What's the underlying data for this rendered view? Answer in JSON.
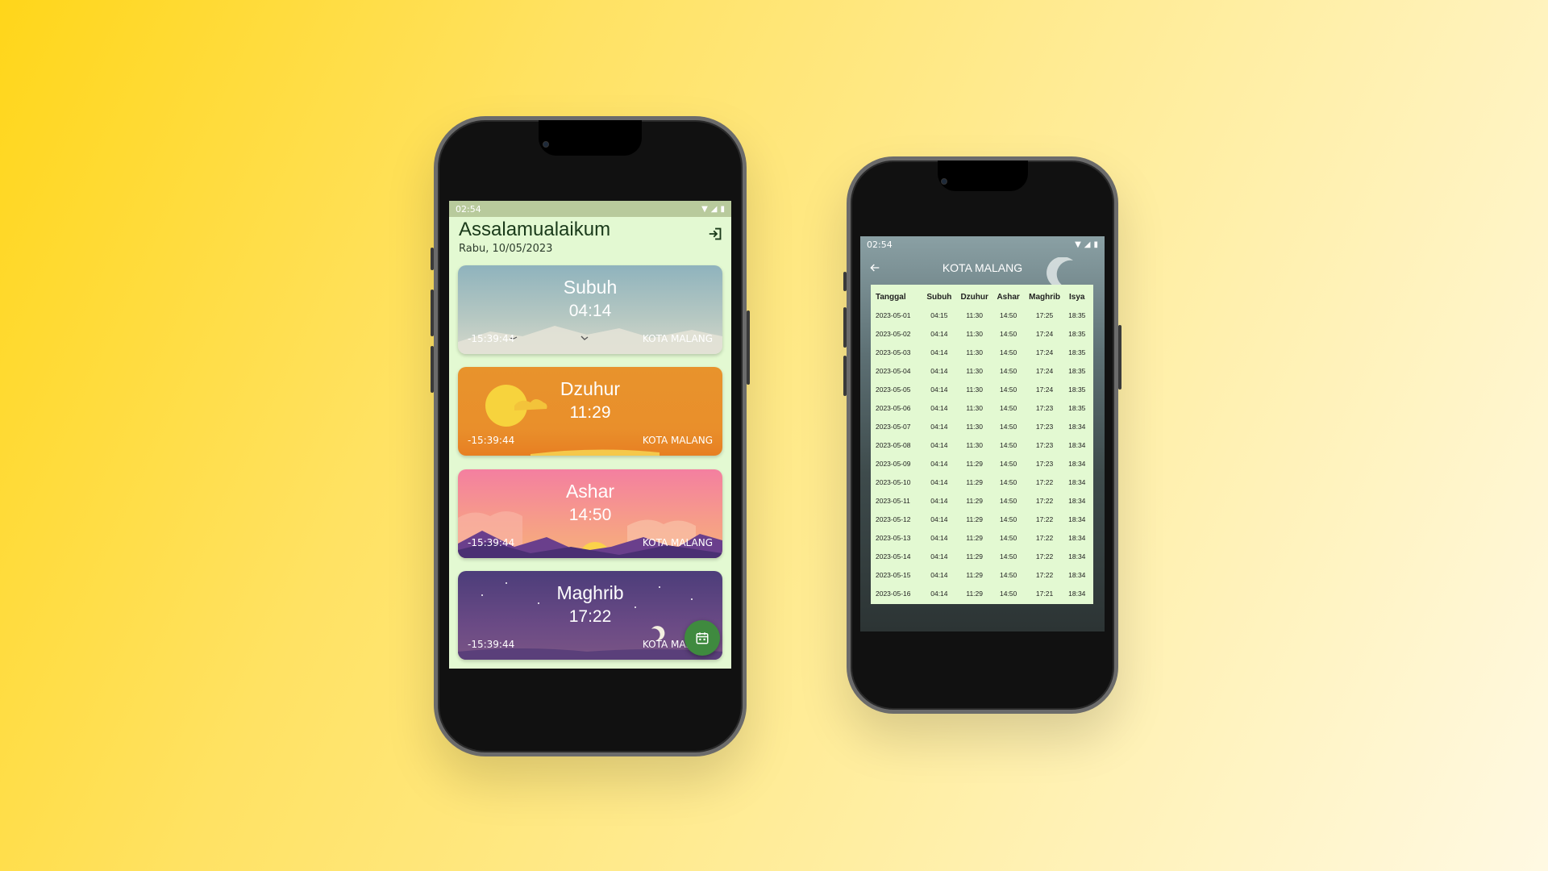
{
  "colors": {
    "accent_green": "#3f8a3f",
    "screen_bg": "#e3f9d2",
    "greeting_text": "#1a3a1a"
  },
  "home": {
    "status": {
      "time": "02:54"
    },
    "greeting": "Assalamualaikum",
    "date": "Rabu, 10/05/2023",
    "logout_icon": "logout-icon",
    "cards": [
      {
        "name": "Subuh",
        "time": "04:14",
        "countdown": "-15:39:44",
        "city": "KOTA MALANG"
      },
      {
        "name": "Dzuhur",
        "time": "11:29",
        "countdown": "-15:39:44",
        "city": "KOTA MALANG"
      },
      {
        "name": "Ashar",
        "time": "14:50",
        "countdown": "-15:39:44",
        "city": "KOTA MALANG"
      },
      {
        "name": "Maghrib",
        "time": "17:22",
        "countdown": "-15:39:44",
        "city": "KOTA MALANG"
      }
    ],
    "fab_icon": "calendar-icon"
  },
  "schedule": {
    "status": {
      "time": "02:54"
    },
    "title": "KOTA MALANG",
    "back_icon": "arrow-back-icon",
    "columns": [
      "Tanggal",
      "Subuh",
      "Dzuhur",
      "Ashar",
      "Maghrib",
      "Isya"
    ],
    "rows": [
      [
        "2023-05-01",
        "04:15",
        "11:30",
        "14:50",
        "17:25",
        "18:35"
      ],
      [
        "2023-05-02",
        "04:14",
        "11:30",
        "14:50",
        "17:24",
        "18:35"
      ],
      [
        "2023-05-03",
        "04:14",
        "11:30",
        "14:50",
        "17:24",
        "18:35"
      ],
      [
        "2023-05-04",
        "04:14",
        "11:30",
        "14:50",
        "17:24",
        "18:35"
      ],
      [
        "2023-05-05",
        "04:14",
        "11:30",
        "14:50",
        "17:24",
        "18:35"
      ],
      [
        "2023-05-06",
        "04:14",
        "11:30",
        "14:50",
        "17:23",
        "18:35"
      ],
      [
        "2023-05-07",
        "04:14",
        "11:30",
        "14:50",
        "17:23",
        "18:34"
      ],
      [
        "2023-05-08",
        "04:14",
        "11:30",
        "14:50",
        "17:23",
        "18:34"
      ],
      [
        "2023-05-09",
        "04:14",
        "11:29",
        "14:50",
        "17:23",
        "18:34"
      ],
      [
        "2023-05-10",
        "04:14",
        "11:29",
        "14:50",
        "17:22",
        "18:34"
      ],
      [
        "2023-05-11",
        "04:14",
        "11:29",
        "14:50",
        "17:22",
        "18:34"
      ],
      [
        "2023-05-12",
        "04:14",
        "11:29",
        "14:50",
        "17:22",
        "18:34"
      ],
      [
        "2023-05-13",
        "04:14",
        "11:29",
        "14:50",
        "17:22",
        "18:34"
      ],
      [
        "2023-05-14",
        "04:14",
        "11:29",
        "14:50",
        "17:22",
        "18:34"
      ],
      [
        "2023-05-15",
        "04:14",
        "11:29",
        "14:50",
        "17:22",
        "18:34"
      ],
      [
        "2023-05-16",
        "04:14",
        "11:29",
        "14:50",
        "17:21",
        "18:34"
      ]
    ]
  }
}
